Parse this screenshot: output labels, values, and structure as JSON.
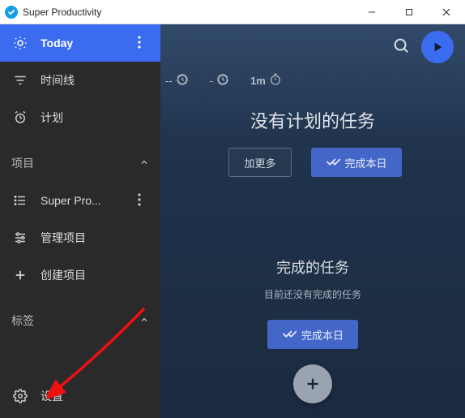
{
  "window": {
    "title": "Super Productivity"
  },
  "sidebar": {
    "today": "Today",
    "timeline": "时间线",
    "plan": "计划",
    "sectionProjects": "项目",
    "projectItem": "Super Pro...",
    "manageProjects": "管理项目",
    "createProject": "创建项目",
    "sectionTags": "标签",
    "settings": "设置"
  },
  "stats": {
    "time1": "--",
    "time2": "-",
    "time3": "1m"
  },
  "main": {
    "noPlanned": "没有计划的任务",
    "addMore": "加更多",
    "completeToday": "完成本日",
    "doneTitle": "完成的任务",
    "noneDone": "目前还没有完成的任务"
  }
}
